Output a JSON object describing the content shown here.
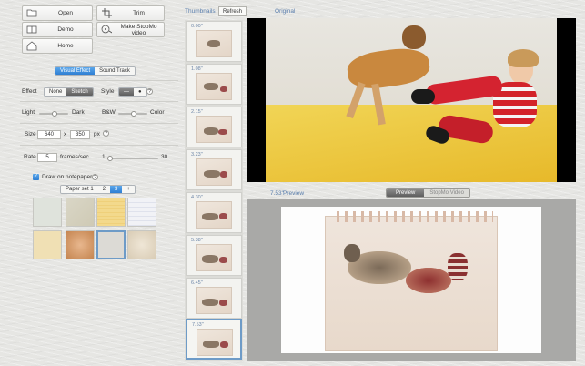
{
  "toolbar": {
    "open": "Open",
    "trim": "Trim",
    "demo": "Demo",
    "make_video": "Make StopMo video",
    "home": "Home"
  },
  "tabs": {
    "visual_effect": "Visual Effect",
    "sound_track": "Sound Track"
  },
  "effect": {
    "label": "Effect",
    "none": "None",
    "sketch": "Sketch",
    "style": "Style"
  },
  "light_dark": {
    "light": "Light",
    "dark": "Dark",
    "bw": "B&W",
    "color": "Color"
  },
  "size": {
    "label": "Size",
    "width": "640",
    "x": "x",
    "height": "350",
    "unit": "px"
  },
  "rate": {
    "label": "Rate",
    "value": "5",
    "unit": "frames/sec",
    "min": "1",
    "max": "30"
  },
  "notepaper": {
    "label": "Draw on notepaper",
    "checked": true,
    "paper_set": "Paper set 1",
    "pages": [
      "2",
      "3",
      "+"
    ]
  },
  "thumbnails": {
    "title": "Thumbnails",
    "refresh": "Refresh",
    "items": [
      "0.00\"",
      "1.08\"",
      "2.15\"",
      "3.23\"",
      "4.30\"",
      "5.38\"",
      "6.45\"",
      "7.53\""
    ]
  },
  "original": {
    "label": "Original"
  },
  "preview": {
    "time": "7.53\"",
    "label": "Preview",
    "tab_preview": "Preview",
    "tab_stopmo": "StopMo Video"
  },
  "colors": {
    "accent": "#3f8ede",
    "link": "#5b7fae"
  }
}
